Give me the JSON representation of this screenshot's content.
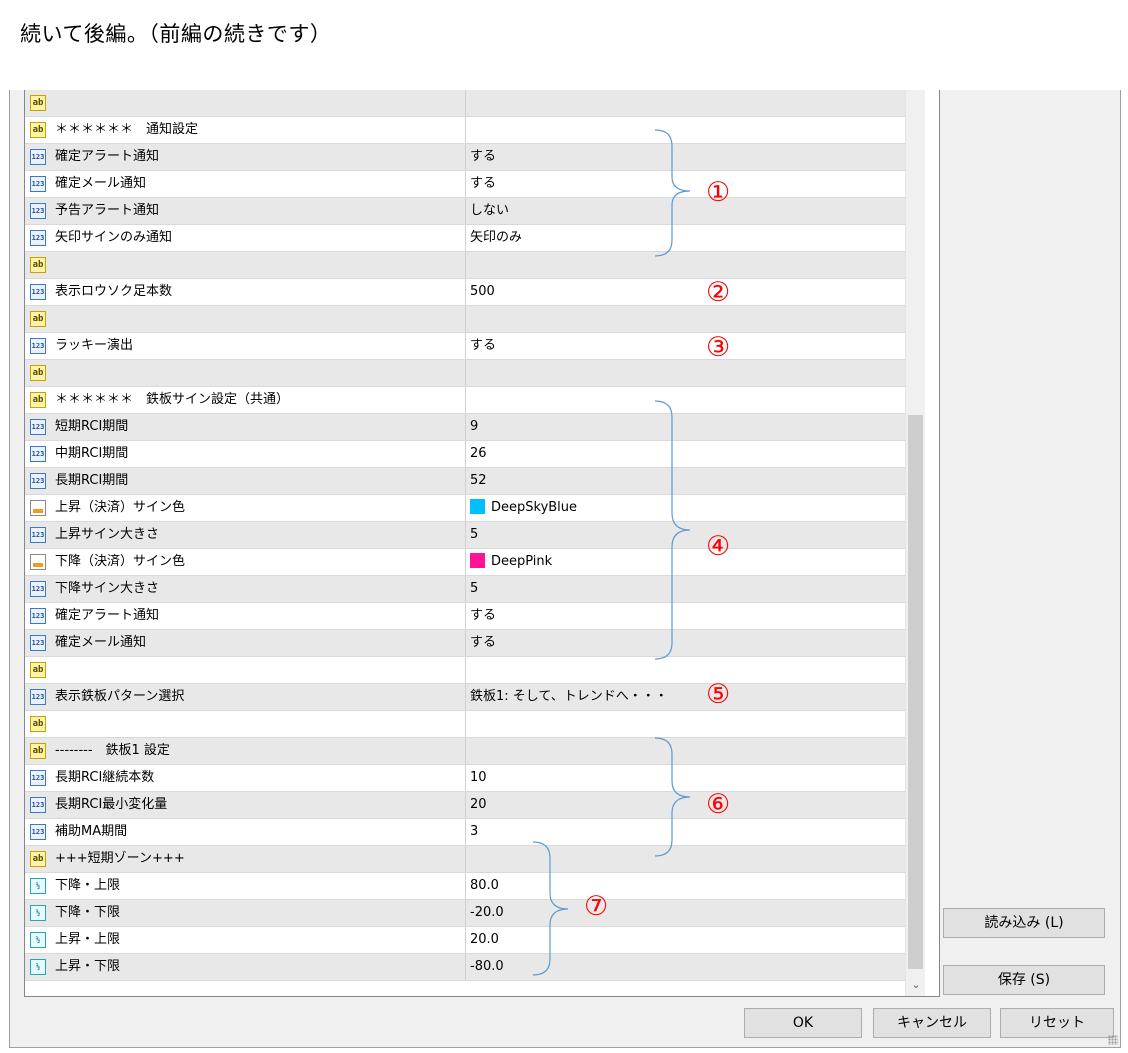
{
  "caption": "続いて後編。（前編の続きです）",
  "rows": [
    {
      "icon": "ab",
      "label": "",
      "value": ""
    },
    {
      "icon": "ab",
      "label": "＊＊＊＊＊＊　通知設定",
      "value": ""
    },
    {
      "icon": "num",
      "label": "確定アラート通知",
      "value": "する"
    },
    {
      "icon": "num",
      "label": "確定メール通知",
      "value": "する"
    },
    {
      "icon": "num",
      "label": "予告アラート通知",
      "value": "しない"
    },
    {
      "icon": "num",
      "label": "矢印サインのみ通知",
      "value": "矢印のみ"
    },
    {
      "icon": "ab",
      "label": "",
      "value": ""
    },
    {
      "icon": "num",
      "label": "表示ロウソク足本数",
      "value": "500"
    },
    {
      "icon": "ab",
      "label": "",
      "value": ""
    },
    {
      "icon": "num",
      "label": "ラッキー演出",
      "value": "する"
    },
    {
      "icon": "ab",
      "label": "",
      "value": ""
    },
    {
      "icon": "ab",
      "label": "＊＊＊＊＊＊　鉄板サイン設定（共通）",
      "value": ""
    },
    {
      "icon": "num",
      "label": "短期RCI期間",
      "value": "9"
    },
    {
      "icon": "num",
      "label": "中期RCI期間",
      "value": "26"
    },
    {
      "icon": "num",
      "label": "長期RCI期間",
      "value": "52"
    },
    {
      "icon": "col",
      "label": "上昇（決済）サイン色",
      "value": "DeepSkyBlue",
      "swatch": "#00bfff"
    },
    {
      "icon": "num",
      "label": "上昇サイン大きさ",
      "value": "5"
    },
    {
      "icon": "col",
      "label": "下降（決済）サイン色",
      "value": "DeepPink",
      "swatch": "#ff1493"
    },
    {
      "icon": "num",
      "label": "下降サイン大きさ",
      "value": "5"
    },
    {
      "icon": "num",
      "label": "確定アラート通知",
      "value": "する"
    },
    {
      "icon": "num",
      "label": "確定メール通知",
      "value": "する"
    },
    {
      "icon": "ab",
      "label": "",
      "value": ""
    },
    {
      "icon": "num",
      "label": "表示鉄板パターン選択",
      "value": "鉄板1: そして、トレンドへ・・・"
    },
    {
      "icon": "ab",
      "label": "",
      "value": ""
    },
    {
      "icon": "ab",
      "label": "--------　鉄板1 設定",
      "value": ""
    },
    {
      "icon": "num",
      "label": "長期RCI継続本数",
      "value": "10"
    },
    {
      "icon": "num",
      "label": "長期RCI最小変化量",
      "value": "20"
    },
    {
      "icon": "num",
      "label": "補助MA期間",
      "value": "3"
    },
    {
      "icon": "ab",
      "label": "+++短期ゾーン+++",
      "value": ""
    },
    {
      "icon": "dbl",
      "label": "下降・上限",
      "value": "80.0"
    },
    {
      "icon": "dbl",
      "label": "下降・下限",
      "value": "-20.0"
    },
    {
      "icon": "dbl",
      "label": "上昇・上限",
      "value": "20.0"
    },
    {
      "icon": "dbl",
      "label": "上昇・下限",
      "value": "-80.0"
    }
  ],
  "annotations": [
    "①",
    "②",
    "③",
    "④",
    "⑤",
    "⑥",
    "⑦"
  ],
  "buttons": {
    "load": "読み込み (L)",
    "save": "保存 (S)",
    "ok": "OK",
    "cancel": "キャンセル",
    "reset": "リセット"
  },
  "colors": {
    "annotation": "#ff0000",
    "brace": "#5b9bd5"
  },
  "icons": {
    "ab": "ab",
    "num": "123",
    "dbl": "½",
    "col": ""
  }
}
